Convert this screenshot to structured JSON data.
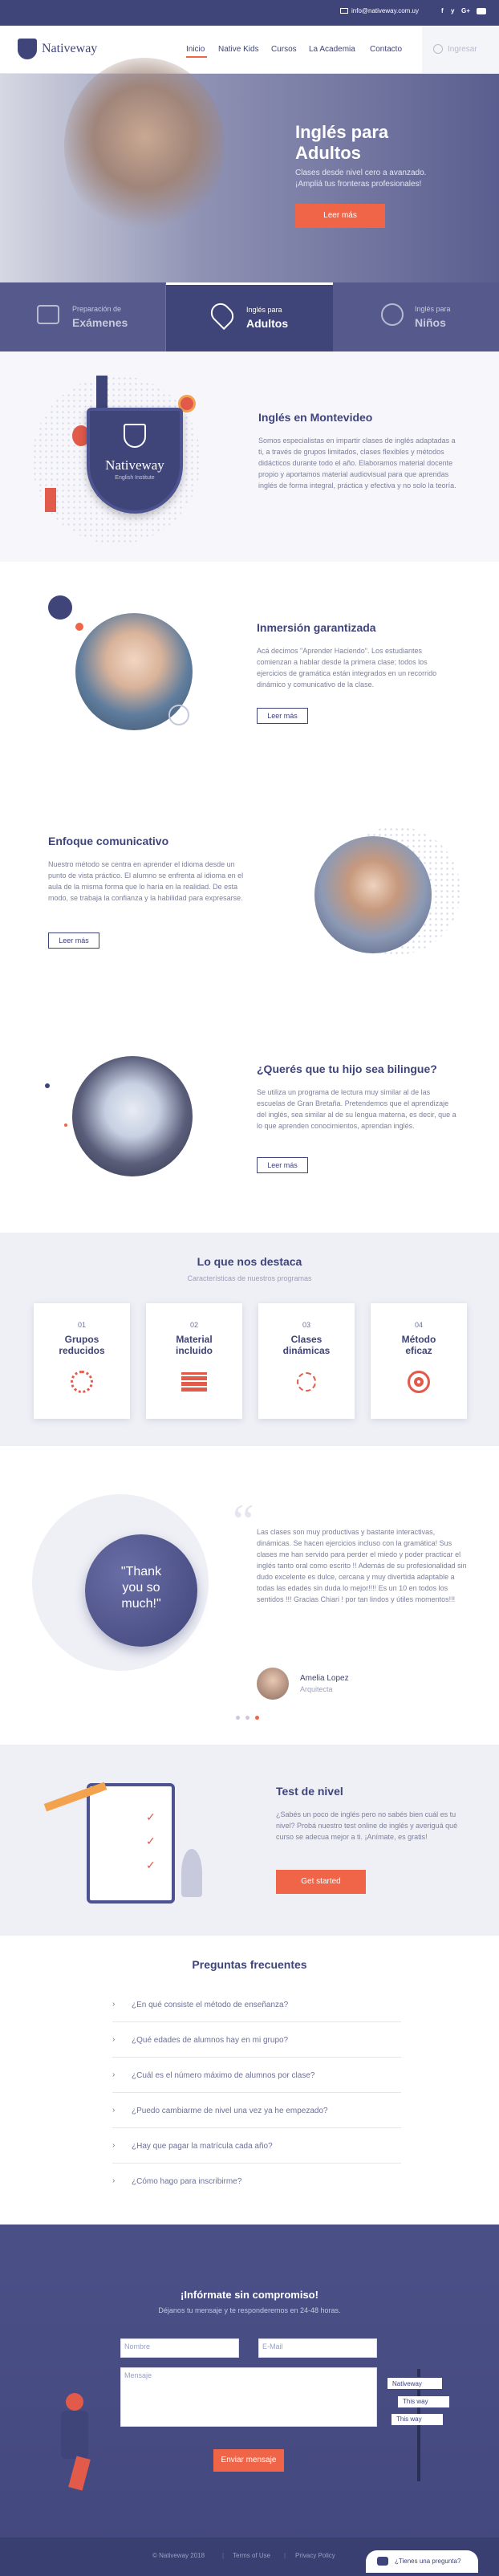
{
  "topbar": {
    "email": "info@nativeway.com.uy",
    "social": [
      "f",
      "y",
      "G+",
      "yt"
    ]
  },
  "nav": {
    "logo": "Nativeway",
    "items": [
      "Inicio",
      "Native Kids",
      "Cursos",
      "La Academia",
      "Contacto"
    ],
    "ingresar": "Ingresar"
  },
  "hero": {
    "title_line1": "Inglés para",
    "title_line2": "Adultos",
    "subtitle_line1": "Clases desde nivel cero a avanzado.",
    "subtitle_line2": "¡Ampliá tus fronteras profesionales!",
    "cta": "Leer más"
  },
  "tabs": [
    {
      "small": "Preparación de",
      "big": "Exámenes"
    },
    {
      "small": "Inglés para",
      "big": "Adultos"
    },
    {
      "small": "Inglés para",
      "big": "Niños"
    }
  ],
  "montevideo": {
    "badge_name": "Nativeway",
    "badge_sub": "English Institute",
    "title": "Inglés en Montevideo",
    "text": "Somos especialistas en impartir clases de inglés adaptadas a ti, a través de grupos limitados, clases flexibles y métodos didácticos durante todo el año. Elaboramos material docente propio y aportamos material audiovisual para que aprendas inglés de forma integral, práctica y efectiva y no solo la teoría."
  },
  "inmersion": {
    "title": "Inmersión garantizada",
    "text": "Acá decimos \"Aprender Haciendo\". Los estudiantes comienzan a hablar desde la primera clase; todos los ejercicios de gramática están integrados en un recorrido dinámico y comunicativo de la clase.",
    "cta": "Leer más"
  },
  "enfoque": {
    "title": "Enfoque comunicativo",
    "text": "Nuestro método se centra en aprender el idioma desde un punto de vista práctico. El alumno se enfrenta al idioma en el aula de la misma forma que lo haría en la realidad. De esta modo, se trabaja la confianza y la habilidad para expresarse.",
    "cta": "Leer más"
  },
  "bilingue": {
    "title": "¿Querés que tu hijo sea bilingue?",
    "text": "Se utiliza un programa de lectura muy similar al de las escuelas de Gran Bretaña. Pretendemos que el aprendizaje del inglés, sea similar al de su lengua materna, es decir, que a lo que aprenden conocimientos, aprendan inglés.",
    "cta": "Leer más"
  },
  "destaca": {
    "title": "Lo que nos destaca",
    "subtitle": "Características de nuestros programas",
    "cards": [
      {
        "num": "01",
        "title_line1": "Grupos",
        "title_line2": "reducidos"
      },
      {
        "num": "02",
        "title_line1": "Material",
        "title_line2": "incluido"
      },
      {
        "num": "03",
        "title_line1": "Clases",
        "title_line2": "dinámicas"
      },
      {
        "num": "04",
        "title_line1": "Método",
        "title_line2": "eficaz"
      }
    ]
  },
  "testimonial": {
    "bubble_line1": "\"Thank",
    "bubble_line2": "you so",
    "bubble_line3": "much!\"",
    "text": "Las clases son muy productivas y bastante interactivas, dinámicas. Se hacen ejercicios incluso con la gramática! Sus clases me han servido para perder el miedo y poder practicar el inglés tanto oral como escrito !! Además de su profesionalidad sin dudo excelente es dulce, cercana y muy divertida adaptable a todas las edades sin duda lo mejor!!!! Es un 10 en todos los sentidos !!! Gracias Chiari ! por tan lindos y útiles momentos!!!",
    "name": "Amelia Lopez",
    "role": "Arquitecta"
  },
  "test": {
    "title": "Test de nivel",
    "text": "¿Sabés un poco de inglés pero no sabés bien cuál es tu nivel? Probá nuestro test online de inglés y averiguá qué curso se adecua mejor a ti. ¡Anímate, es gratis!",
    "cta": "Get started"
  },
  "faq": {
    "title": "Preguntas frecuentes",
    "items": [
      "¿En qué consiste el método de enseñanza?",
      "¿Qué edades de alumnos hay en mi grupo?",
      "¿Cuál es el número máximo de alumnos por clase?",
      "¿Puedo cambiarme de nivel una vez ya he empezado?",
      "¿Hay que pagar la matrícula cada año?",
      "¿Cómo hago para inscribirme?"
    ]
  },
  "contact": {
    "title": "¡Infórmate sin compromiso!",
    "subtitle": "Déjanos tu mensaje y te responderemos en 24-48 horas.",
    "name_ph": "Nombre",
    "email_ph": "E-Mail",
    "msg_ph": "Mensaje",
    "cta": "Enviar mensaje",
    "sign1": "Nativeway",
    "sign2": "This way",
    "sign3": "This way"
  },
  "footer": {
    "copyright": "© Nativeway 2018",
    "terms": "Terms of Use",
    "privacy": "Privacy Policy",
    "chat": "¿Tienes una pregunta?"
  },
  "colors": {
    "primary": "#3f4479",
    "accent": "#f06548",
    "lavender": "#8f92b3"
  }
}
